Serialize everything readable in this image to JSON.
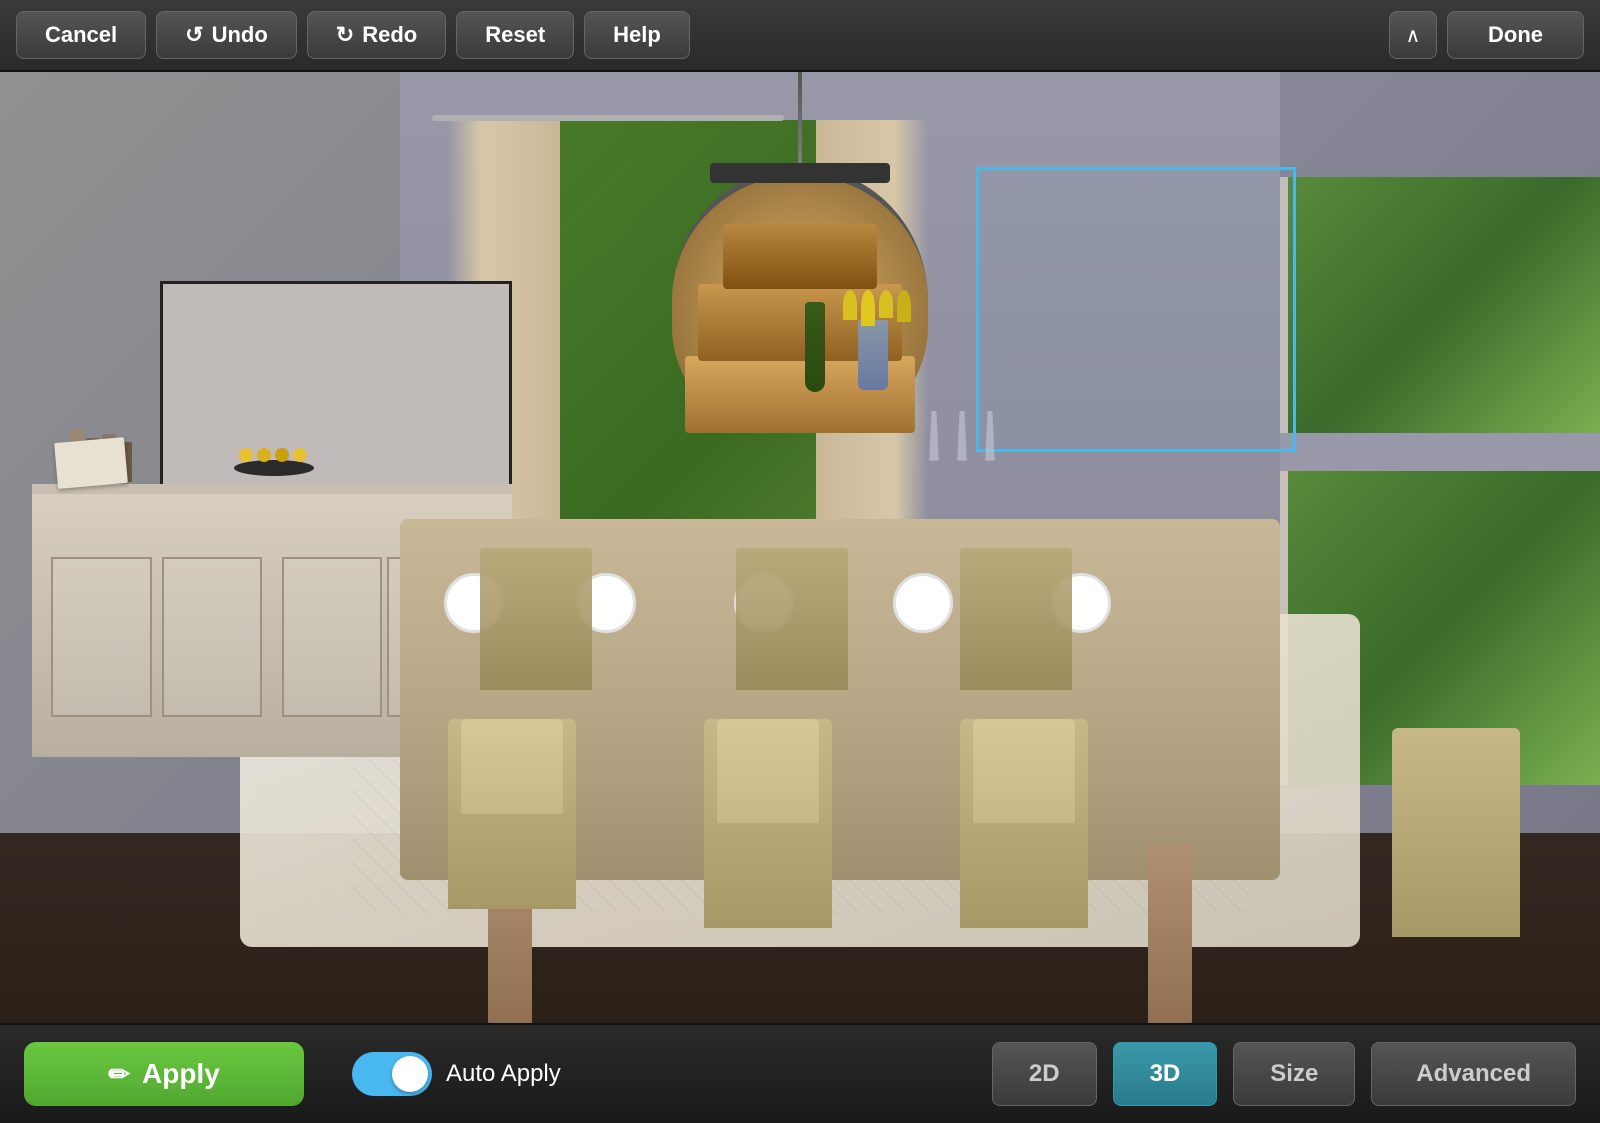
{
  "toolbar": {
    "cancel_label": "Cancel",
    "undo_label": "Undo",
    "redo_label": "Redo",
    "reset_label": "Reset",
    "help_label": "Help",
    "done_label": "Done",
    "chevron_symbol": "∧"
  },
  "scene": {
    "description": "Dining room 3D visualization with chandelier, dining table, sideboard, rug, and windows"
  },
  "bottom_bar": {
    "apply_label": "Apply",
    "apply_icon": "✏",
    "auto_apply_label": "Auto Apply",
    "toggle_state": "on",
    "mode_2d_label": "2D",
    "mode_3d_label": "3D",
    "size_label": "Size",
    "advanced_label": "Advanced"
  },
  "colors": {
    "accent_blue": "#4ab8e8",
    "apply_green": "#5ab830",
    "mode_active_blue": "#2a8a9a",
    "toolbar_bg": "#2e2e2e",
    "bottom_bar_bg": "#1e1e1e"
  }
}
